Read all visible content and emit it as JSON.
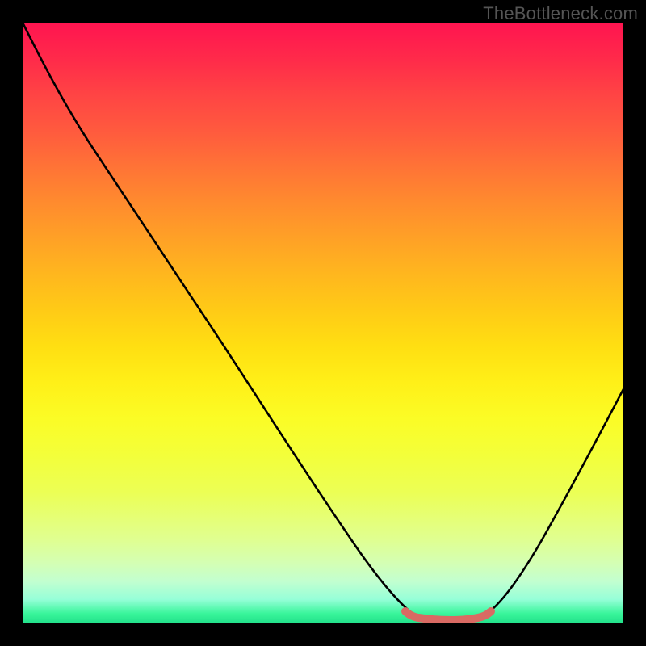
{
  "watermark": "TheBottleneck.com",
  "chart_data": {
    "type": "line",
    "title": "",
    "xlabel": "",
    "ylabel": "",
    "xlim": [
      0,
      100
    ],
    "ylim": [
      0,
      100
    ],
    "grid": false,
    "series": [
      {
        "name": "bottleneck-curve",
        "x": [
          0,
          4,
          12,
          22,
          34,
          46,
          56,
          62,
          66,
          70,
          74,
          77,
          82,
          88,
          94,
          100
        ],
        "y": [
          100,
          94,
          82,
          67,
          49,
          30,
          14,
          5,
          1,
          0,
          0,
          1,
          6,
          16,
          29,
          42
        ]
      },
      {
        "name": "optimal-range-marker",
        "x": [
          62,
          64,
          66,
          68,
          70,
          72,
          74,
          76,
          77
        ],
        "y": [
          1.6,
          0.8,
          0.3,
          0.2,
          0.2,
          0.2,
          0.3,
          0.8,
          1.6
        ]
      }
    ],
    "gradient_legend": {
      "top_color": "#ff1450",
      "top_meaning": "high-bottleneck",
      "bottom_color": "#22e08a",
      "bottom_meaning": "no-bottleneck"
    }
  }
}
